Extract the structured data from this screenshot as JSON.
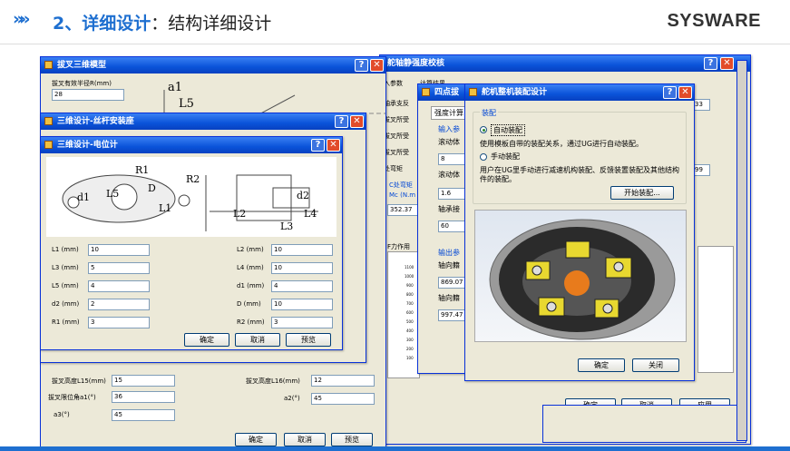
{
  "header": {
    "arrows": "»»",
    "num": "2、",
    "section": "详细设计",
    "colon": "：",
    "subtitle": "结构详细设计",
    "logo": "SYSWARE"
  },
  "win_model": {
    "title": "拔叉三维模型",
    "radius_label": "拔叉有效半径R(mm)",
    "radius_value": "28",
    "height15_label": "拔叉高度L15(mm)",
    "height15_value": "15",
    "height16_label": "拔叉高度L16(mm)",
    "height16_value": "12",
    "a1_label": "拔叉限位角a1(°)",
    "a1_value": "36",
    "a2_label": "a2(°)",
    "a2_value": "45",
    "a3_label": "a3(°)",
    "a3_value": "45",
    "sketch_a1": "a1",
    "sketch_l5": "L5",
    "ok": "确定",
    "cancel": "取消",
    "preview": "预览"
  },
  "win_screw": {
    "title": "三维设计-丝杆安装座"
  },
  "win_pot": {
    "title": "三维设计-电位计",
    "dim_r1": "R1",
    "dim_r2": "R2",
    "dim_d1": "d1",
    "dim_d": "D",
    "dim_l5": "L5",
    "dim_l1": "L1",
    "dim_d2": "d2",
    "dim_l2": "L2",
    "dim_l3": "L3",
    "dim_l4": "L4",
    "fields": [
      {
        "label": "L1 (mm)",
        "value": "10"
      },
      {
        "label": "L2 (mm)",
        "value": "10"
      },
      {
        "label": "L3 (mm)",
        "value": "5"
      },
      {
        "label": "L4 (mm)",
        "value": "10"
      },
      {
        "label": "L5 (mm)",
        "value": "4"
      },
      {
        "label": "d1 (mm)",
        "value": "4"
      },
      {
        "label": "d2 (mm)",
        "value": "2"
      },
      {
        "label": "D (mm)",
        "value": "10"
      },
      {
        "label": "R1 (mm)",
        "value": "3"
      },
      {
        "label": "R2 (mm)",
        "value": "3"
      }
    ],
    "ok": "确定",
    "cancel": "取消",
    "preview": "预览"
  },
  "win_static": {
    "title": "舵轴静强度校核",
    "tab1": "入参数",
    "tab2": "计算结果",
    "rows": [
      "轴承支反",
      "拔叉所受",
      "拔叉所受",
      "拔叉所受",
      "处弯矩",
      "C处弯矩",
      "Mc (N.m"
    ],
    "v1": "33",
    "v2": "99",
    "v3": "352.37",
    "force": "F力作用",
    "ok": "确定",
    "cancel": "取消",
    "apply": "应用",
    "ticks": [
      "1100",
      "1000",
      "900",
      "800",
      "700",
      "600",
      "500",
      "400",
      "300",
      "200",
      "100"
    ]
  },
  "win_fourpt": {
    "title": "四点拔",
    "tab": "强度计算",
    "in_group": "输入参",
    "l1": "滚动体",
    "v1": "8",
    "l2": "滚动体",
    "v2": "1.6",
    "l3": "轴承接",
    "v3": "60",
    "out_group": "输出参",
    "o1": "轴向籍",
    "ov1": "869.07",
    "o2": "轴向籍",
    "ov2": "997.47"
  },
  "win_asm": {
    "title": "舵机整机装配设计",
    "group": "装配",
    "auto": "自动装配",
    "auto_desc": "使用模板自带的装配关系，通过UG进行自动装配。",
    "manual": "手动装配",
    "manual_desc": "用户在UG里手动进行减速机构装配、反馈装置装配及其他结构件的装配。",
    "start": "开始装配...",
    "ok": "确定",
    "close": "关闭"
  }
}
